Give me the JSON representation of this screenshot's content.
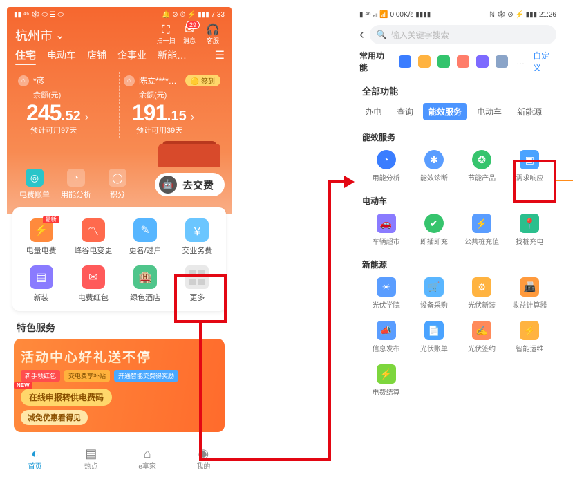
{
  "phoneA": {
    "status": {
      "left": "▮▮ ⁴⁶ 🕸 ⬭ ☰ ⬭",
      "right": "🔔 ⊘ ⏱ ⚡ ▮▮▮ 7:33"
    },
    "city": "杭州市",
    "topIcons": {
      "scan": "扫一扫",
      "msg": "消息",
      "msgBadge": "29",
      "cs": "客服"
    },
    "tabs": [
      "住宅",
      "电动车",
      "店铺",
      "企事业",
      "新能…"
    ],
    "cards": [
      {
        "name": "*彦",
        "balLabel": "余额(元)",
        "int": "245",
        "dec": "52",
        "pred": "预计可用97天"
      },
      {
        "name": "陈立****…",
        "balLabel": "余额(元)",
        "int": "191",
        "dec": "15",
        "pred": "预计可用39天",
        "signin": "签到"
      }
    ],
    "actions": {
      "bill": "电费账单",
      "analysis": "用能分析",
      "points": "积分",
      "pay": "去交费"
    },
    "grid": [
      {
        "label": "电量电费",
        "color": "#ff8a3c",
        "glyph": "⚡",
        "tag": "最新"
      },
      {
        "label": "峰谷电变更",
        "color": "#ff6a4d",
        "glyph": "〽"
      },
      {
        "label": "更名/过户",
        "color": "#57b6ff",
        "glyph": "✎"
      },
      {
        "label": "交业务费",
        "color": "#6bc6ff",
        "glyph": "￥"
      },
      {
        "label": "新装",
        "color": "#8a7bff",
        "glyph": "▤"
      },
      {
        "label": "电费红包",
        "color": "#ff5a5a",
        "glyph": "✉"
      },
      {
        "label": "绿色酒店",
        "color": "#4fc58b",
        "glyph": "🏨"
      },
      {
        "label": "更多",
        "more": true
      }
    ],
    "special": "特色服务",
    "banner": {
      "title": "活动中心好礼送不停",
      "tags": [
        "新手领红包",
        "交电费享补贴",
        "开通智能交费得奖励"
      ],
      "newTag": "NEW",
      "btn": "在线申报转供电费码",
      "sub": "减免优惠看得见"
    },
    "nav": [
      "首页",
      "热点",
      "e享家",
      "我的"
    ]
  },
  "phoneB": {
    "status": {
      "left": "▮ ⁴⁶ ₐₗₗ 📶 0.00K/s ▮▮▮▮",
      "right": "ℕ 🕸 ⊘ ⚡ ▮▮▮ 21:26"
    },
    "searchPlaceholder": "输入关键字搜索",
    "quick": {
      "label": "常用功能",
      "custom": "自定义"
    },
    "qColors": [
      "#3a7dff",
      "#ffb340",
      "#33c46d",
      "#ff7d6a",
      "#7d6aff",
      "#8aa4c8"
    ],
    "allLabel": "全部功能",
    "catTabs": [
      "办电",
      "查询",
      "能效服务",
      "电动车",
      "新能源"
    ],
    "catActive": 2,
    "sections": [
      {
        "title": "能效服务",
        "items": [
          {
            "label": "用能分析",
            "color": "#3a7dff",
            "glyph": "◔",
            "circle": true
          },
          {
            "label": "能效诊断",
            "color": "#5a9dff",
            "glyph": "✱",
            "circle": true
          },
          {
            "label": "节能产品",
            "color": "#36c46d",
            "glyph": "❂",
            "circle": true
          },
          {
            "label": "需求响应",
            "color": "#4aa3ff",
            "glyph": "▣",
            "highlight": true
          }
        ]
      },
      {
        "title": "电动车",
        "items": [
          {
            "label": "车辆超市",
            "color": "#8a7bff",
            "glyph": "🚗"
          },
          {
            "label": "即插即充",
            "color": "#36c46d",
            "glyph": "✔",
            "circle": true
          },
          {
            "label": "公共桩充值",
            "color": "#5a9dff",
            "glyph": "⚡"
          },
          {
            "label": "找桩充电",
            "color": "#2bbf8d",
            "glyph": "📍"
          }
        ]
      },
      {
        "title": "新能源",
        "items": [
          {
            "label": "光伏学院",
            "color": "#5a9dff",
            "glyph": "☀"
          },
          {
            "label": "设备采购",
            "color": "#5ab6ff",
            "glyph": "🛒"
          },
          {
            "label": "光伏新装",
            "color": "#ffb340",
            "glyph": "⚙"
          },
          {
            "label": "收益计算器",
            "color": "#ff9a3d",
            "glyph": "📠"
          },
          {
            "label": "信息发布",
            "color": "#5a9dff",
            "glyph": "📣"
          },
          {
            "label": "光伏账单",
            "color": "#4aa3ff",
            "glyph": "📄"
          },
          {
            "label": "光伏签约",
            "color": "#ff8a5a",
            "glyph": "✍"
          },
          {
            "label": "智能运维",
            "color": "#ffb340",
            "glyph": "⚡"
          },
          {
            "label": "电费结算",
            "color": "#7dd63d",
            "glyph": "⚡"
          }
        ]
      }
    ]
  }
}
